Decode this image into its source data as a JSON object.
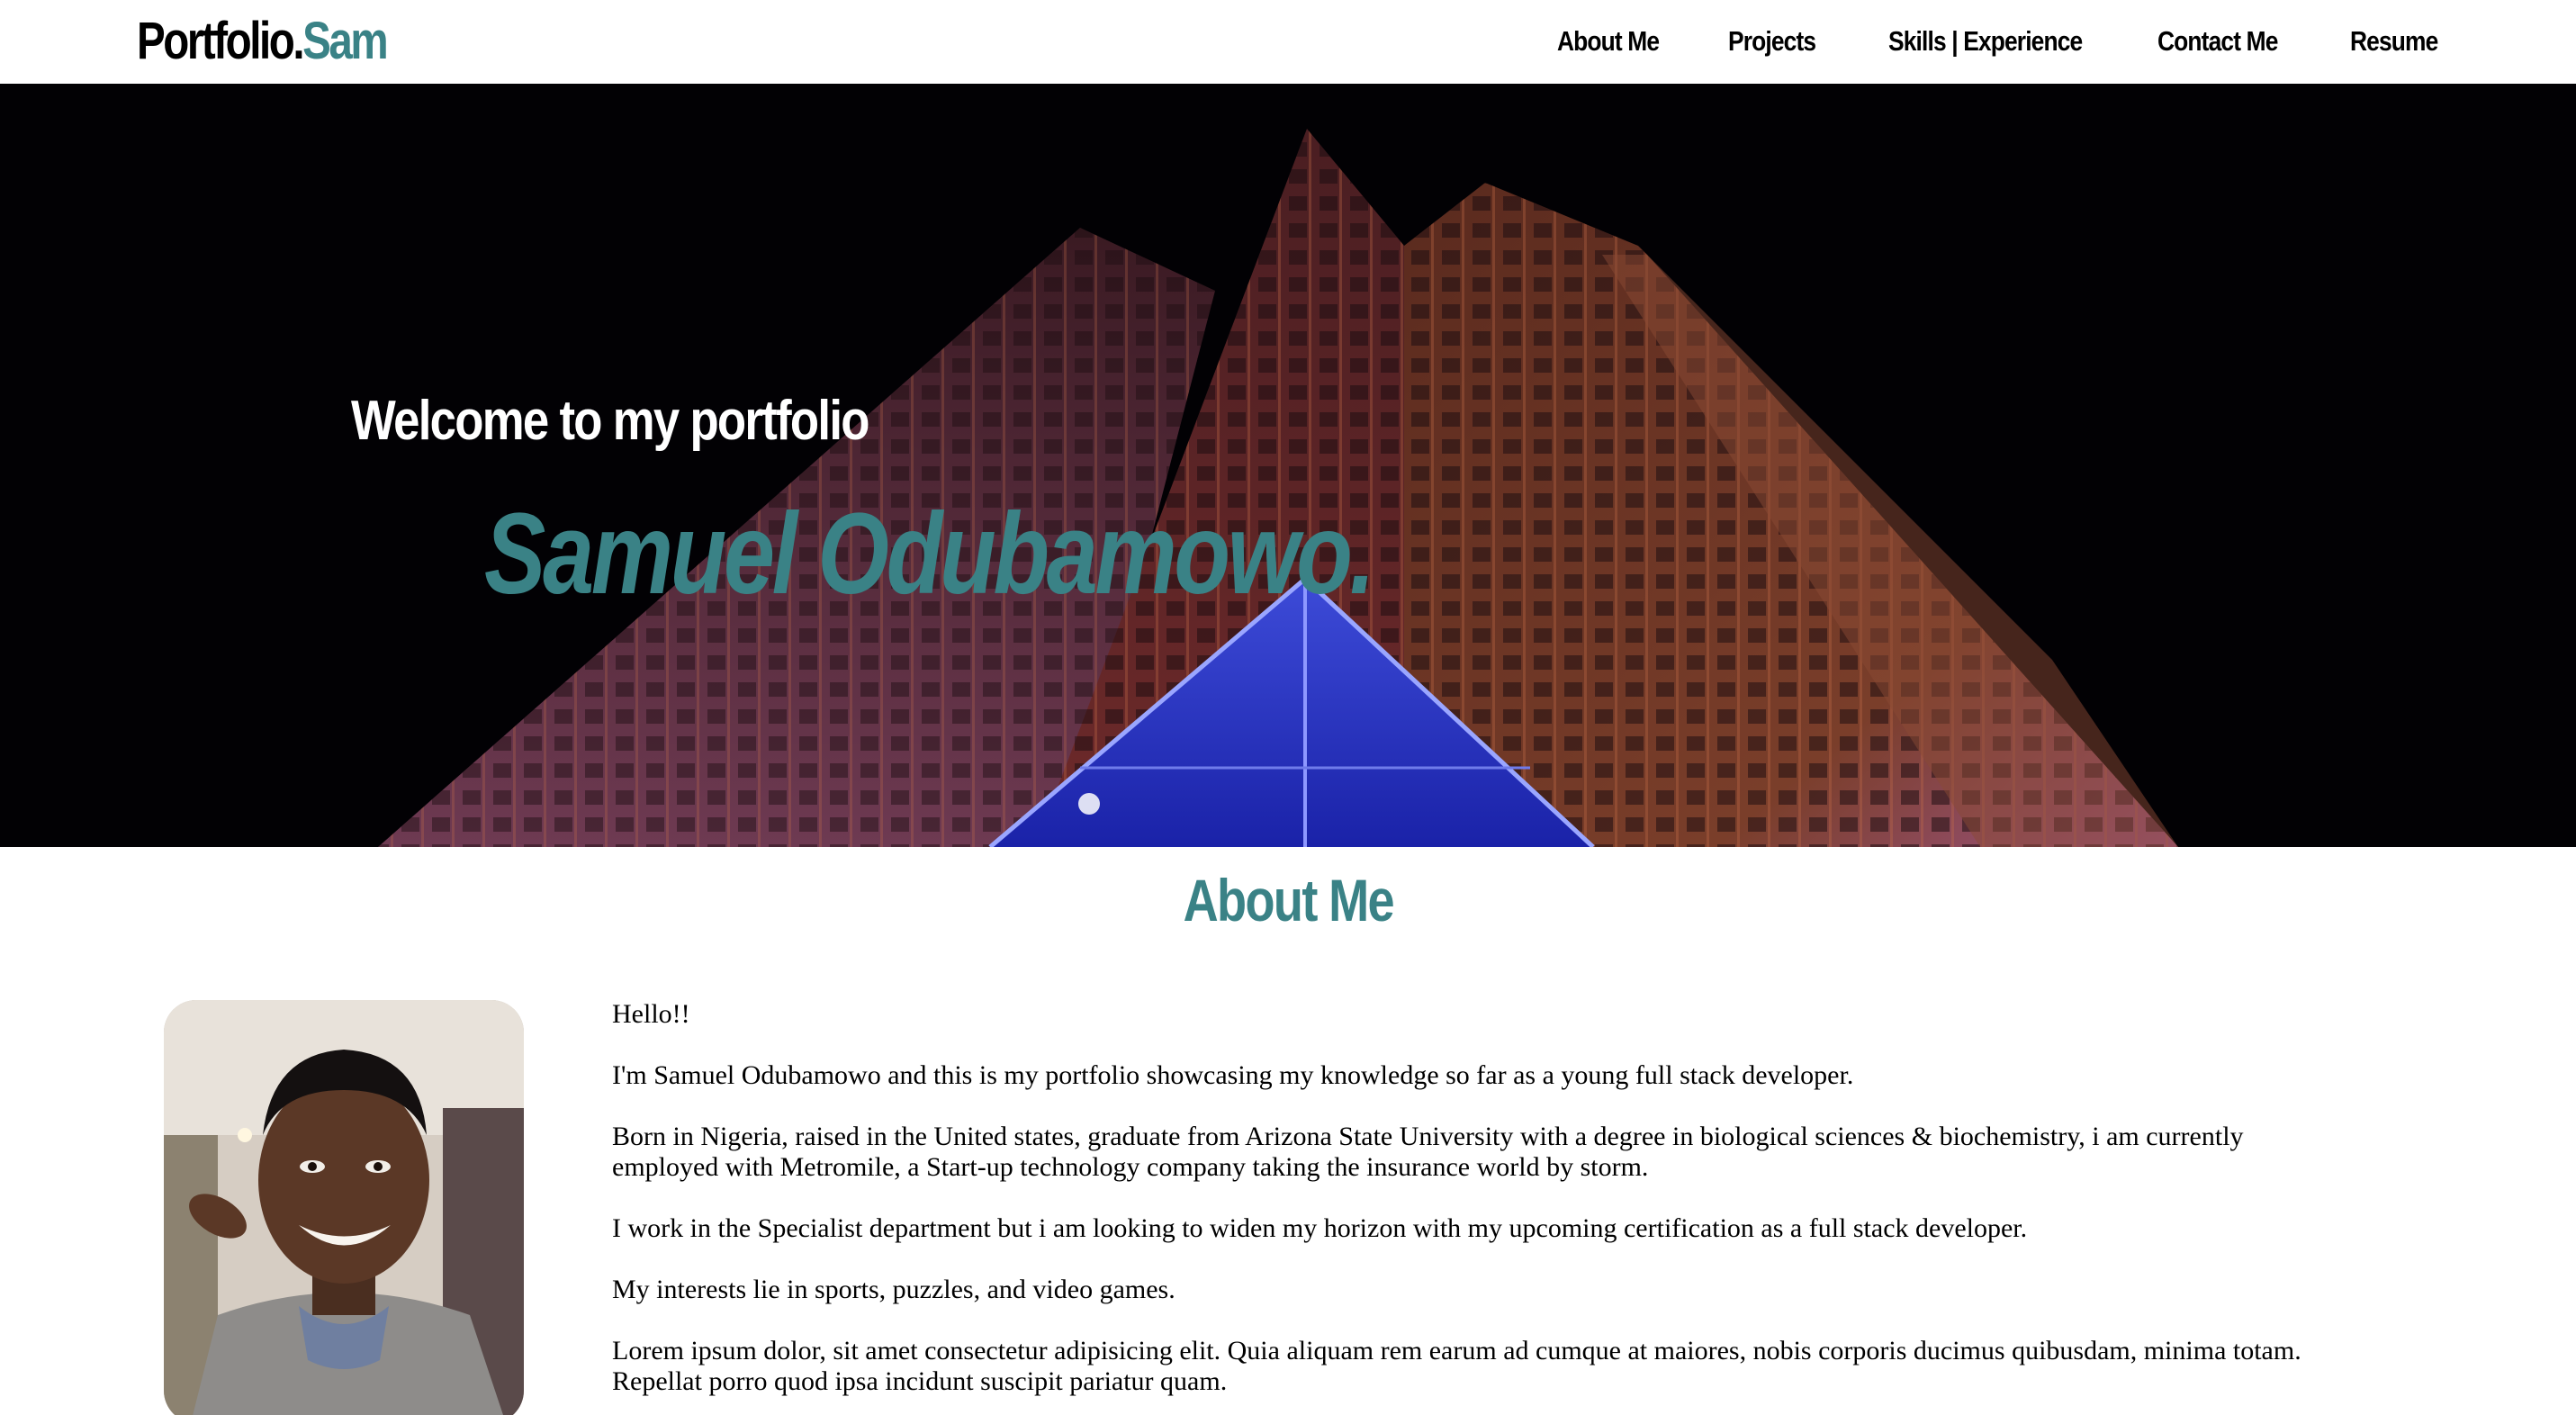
{
  "navbar": {
    "brand_main": "Portfolio.",
    "brand_accent": "Sam",
    "links": [
      "About Me",
      "Projects",
      "Skills | Experience",
      "Contact Me",
      "Resume"
    ]
  },
  "hero": {
    "welcome": "Welcome to my portfolio",
    "name": "Samuel Odubamowo."
  },
  "about": {
    "heading": "About Me",
    "paragraphs": [
      "Hello!!",
      "I'm Samuel Odubamowo and this is my portfolio showcasing my knowledge so far as a young full stack developer.",
      "Born in Nigeria, raised in the United states, graduate from Arizona State University with a degree in biological sciences & biochemistry, i am currently employed with Metromile, a Start-up technology company taking the insurance world by storm.",
      "I work in the Specialist department but i am looking to widen my horizon with my upcoming certification as a full stack developer.",
      "My interests lie in sports, puzzles, and video games.",
      "Lorem ipsum dolor, sit amet consectetur adipisicing elit. Quia aliquam rem earum ad cumque at maiores, nobis corporis ducimus quibusdam, minima totam. Repellat porro quod ipsa incidunt suscipit pariatur quam."
    ]
  },
  "colors": {
    "accent": "#3a8286",
    "text": "#000000",
    "hero_background": "#020104"
  }
}
